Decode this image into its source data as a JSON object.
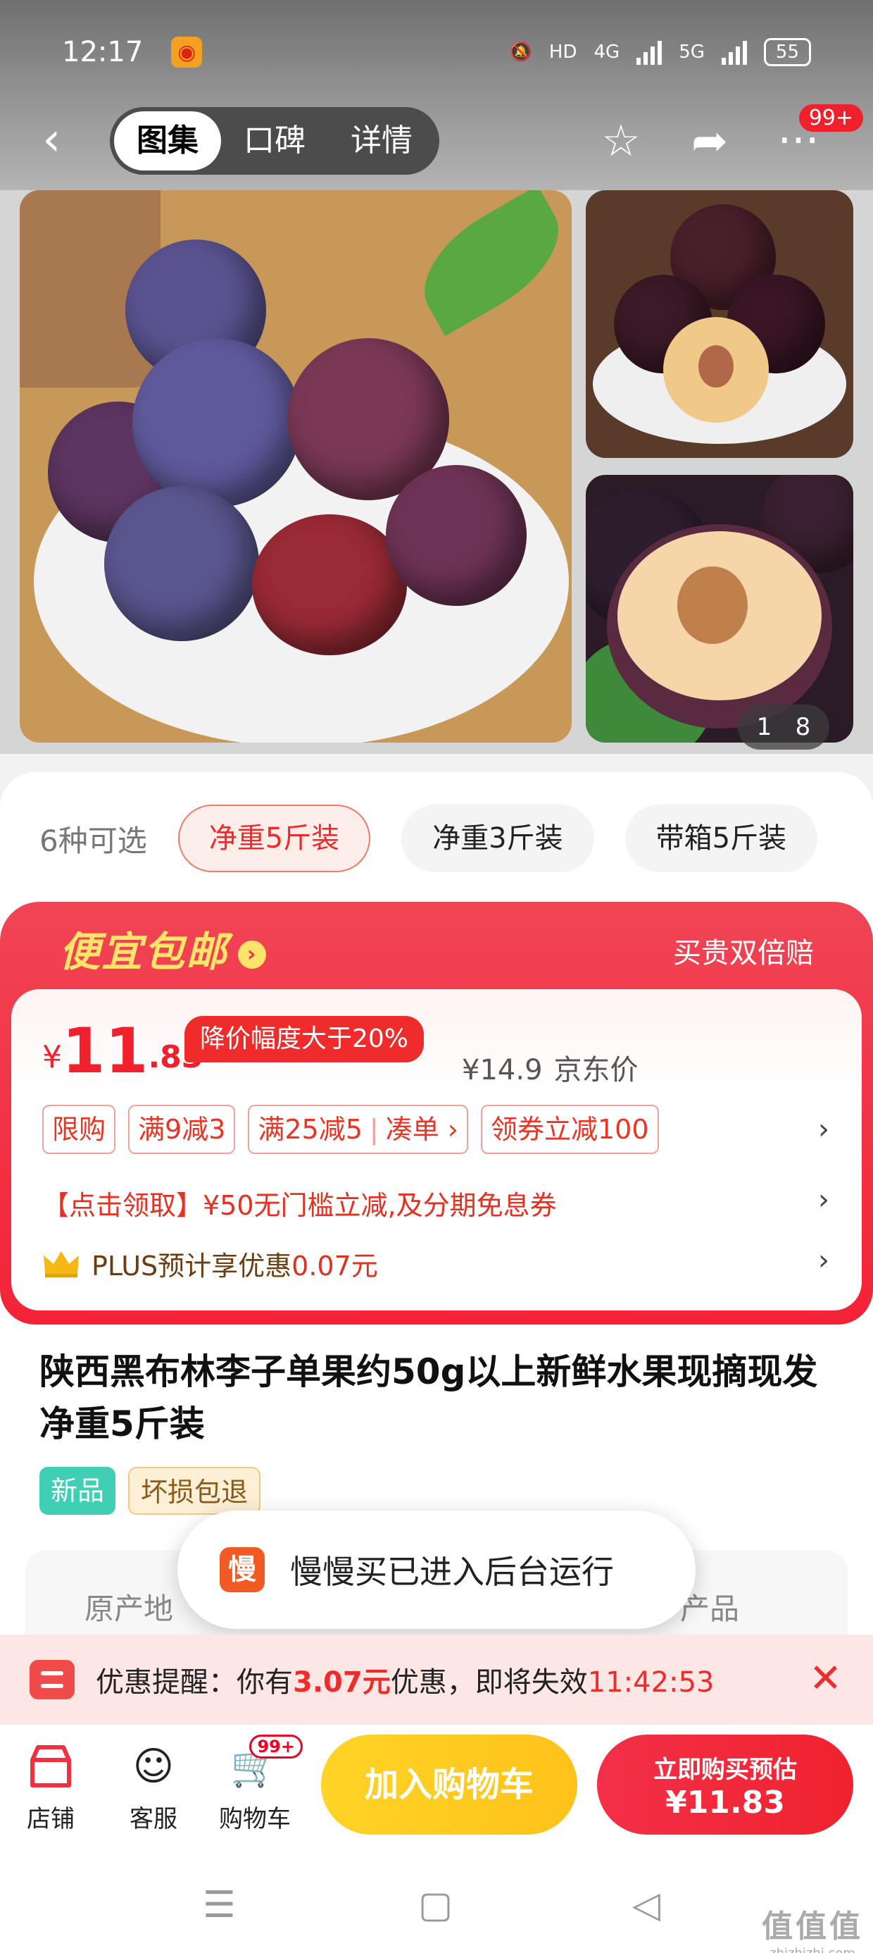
{
  "status_bar": {
    "time": "12:17",
    "network_hd": "HD",
    "net1": "4G",
    "net2": "5G",
    "battery": "55"
  },
  "nav": {
    "tabs": [
      {
        "label": "图集",
        "active": true
      },
      {
        "label": "口碑"
      },
      {
        "label": "详情"
      }
    ],
    "more_badge": "99+"
  },
  "gallery": {
    "current": "1",
    "total": "8"
  },
  "variants": {
    "count_label": "6种可选",
    "options": [
      {
        "label": "净重5斤装",
        "selected": true
      },
      {
        "label": "净重3斤装"
      },
      {
        "label": "带箱5斤装"
      }
    ]
  },
  "promo": {
    "title": "便宜包邮",
    "right_label": "买贵双倍赔",
    "price_symbol": "¥",
    "price_int": "11",
    "price_dec": ".83",
    "price_cut_tag": "降价幅度大于20%",
    "jd_price": "¥14.9",
    "jd_label": "京东价",
    "tags": [
      "限购",
      "满9减3",
      "满25减5",
      "凑单 ›",
      "领券立减100"
    ],
    "coupon_text": "【点击领取】¥50无门槛立减,及分期免息券",
    "plus_text": "PLUS预计享优惠",
    "plus_amount": "0.07元"
  },
  "product": {
    "title": "陕西黑布林李子单果约50g以上新鲜水果现摘现发 净重5斤装",
    "tags": [
      "新品",
      "坏损包退"
    ],
    "attr_left": "原产地",
    "attr_right": "产品"
  },
  "toast": {
    "icon_char": "慢",
    "text": "慢慢买已进入后台运行"
  },
  "reminder": {
    "prefix": "优惠提醒：你有",
    "amount": "3.07元",
    "middle": "优惠，即将失效",
    "timer": "11:42:53"
  },
  "bottom_bar": {
    "shop": "店铺",
    "service": "客服",
    "cart": "购物车",
    "cart_badge": "99+",
    "add_cart": "加入购物车",
    "buy_line1": "立即购买预估",
    "buy_line2": "¥11.83"
  },
  "watermark": {
    "big": "值值值",
    "small": "zhizhizhi.com"
  },
  "colors": {
    "accent": "#f0202c",
    "promo_yellow": "#ffe46a",
    "cart_yellow": "#ffc21a"
  }
}
